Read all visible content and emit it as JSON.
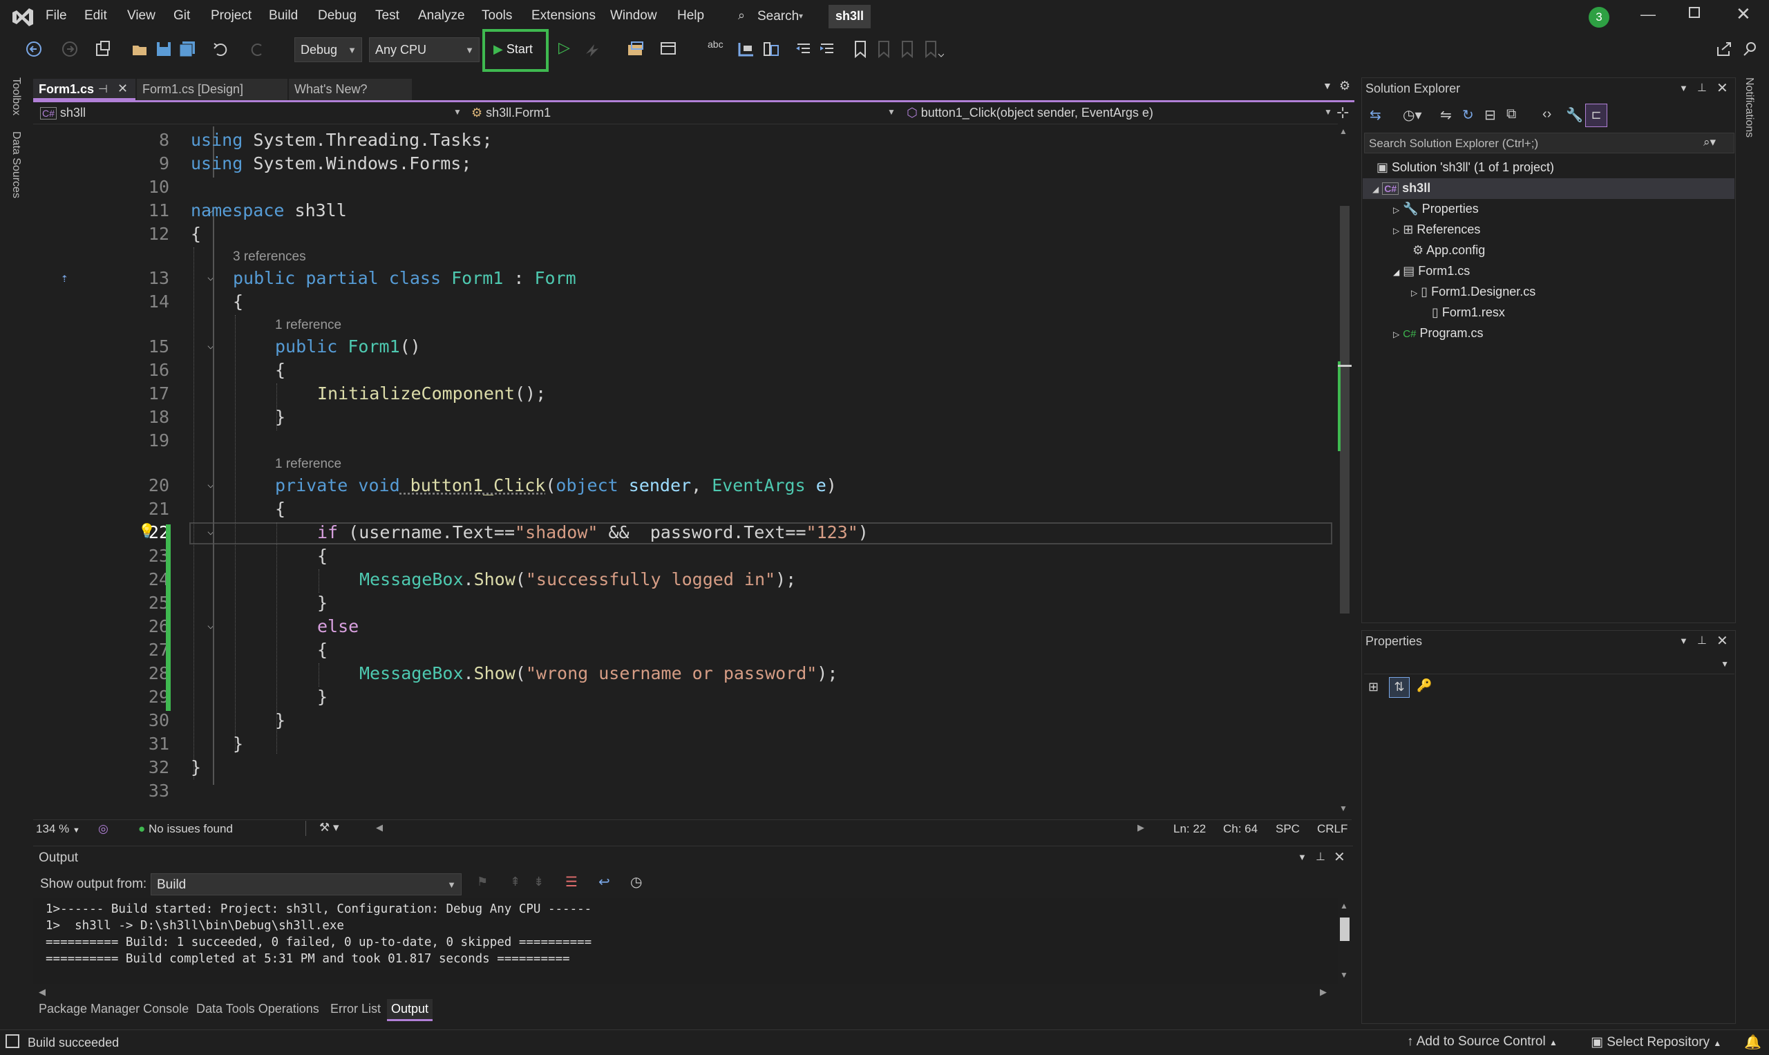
{
  "menu": [
    "File",
    "Edit",
    "View",
    "Git",
    "Project",
    "Build",
    "Debug",
    "Test",
    "Analyze",
    "Tools",
    "Extensions",
    "Window",
    "Help"
  ],
  "search_label": "Search",
  "solution_badge": "sh3ll",
  "notification_count": "3",
  "toolbar": {
    "config": "Debug",
    "platform": "Any CPU",
    "start_label": "Start"
  },
  "side_left": [
    "Toolbox",
    "Data Sources"
  ],
  "side_right": [
    "Notifications"
  ],
  "tabs": [
    {
      "label": "Form1.cs",
      "active": true
    },
    {
      "label": "Form1.cs [Design]",
      "active": false
    },
    {
      "label": "What's New?",
      "active": false
    }
  ],
  "nav": {
    "project": "sh3ll",
    "class": "sh3ll.Form1",
    "member": "button1_Click(object sender, EventArgs e)"
  },
  "code": {
    "line_numbers": [
      "8",
      "9",
      "10",
      "11",
      "12",
      "13",
      "14",
      "15",
      "16",
      "17",
      "18",
      "19",
      "20",
      "21",
      "22",
      "23",
      "24",
      "25",
      "26",
      "27",
      "28",
      "29",
      "30",
      "31",
      "32",
      "33"
    ],
    "l8_kw": "using",
    "l8_rest": " System.Threading.Tasks;",
    "l9_kw": "using",
    "l9_rest": " System.Windows.Forms;",
    "l11_kw": "namespace",
    "l11_name": " sh3ll",
    "l12": "{",
    "lens_class": "3 references",
    "l13_kw": "public partial class",
    "l13_name": " Form1",
    "l13_colon": " : ",
    "l13_base": "Form",
    "l14": "{",
    "lens_ctor": "1 reference",
    "l15_kw": "public",
    "l15_name": " Form1",
    "l15_par": "()",
    "l16": "{",
    "l17_fn": "InitializeComponent",
    "l17_rest": "();",
    "l18": "}",
    "lens_click": "1 reference",
    "l20_kw": "private void",
    "l20_fn": " button1_Click",
    "l20_p1": "(",
    "l20_t1": "object",
    "l20_n1": " sender",
    "l20_c": ", ",
    "l20_t2": "EventArgs",
    "l20_n2": " e",
    "l20_p2": ")",
    "l21": "{",
    "l22_ctl": "if",
    "l22_a": " (",
    "l22_b": "username",
    "l22_c": ".",
    "l22_d": "Text",
    "l22_e": "==",
    "l22_s1": "\"shadow\"",
    "l22_f": " &&  ",
    "l22_g": "password",
    "l22_h": ".",
    "l22_i": "Text",
    "l22_j": "==",
    "l22_s2": "\"123\"",
    "l22_k": ")",
    "l23": "{",
    "l24_ty": "MessageBox",
    "l24_dot": ".",
    "l24_fn": "Show",
    "l24_p": "(",
    "l24_s": "\"successfully logged in\"",
    "l24_e": ");",
    "l25": "}",
    "l26_ctl": "else",
    "l27": "{",
    "l28_ty": "MessageBox",
    "l28_dot": ".",
    "l28_fn": "Show",
    "l28_p": "(",
    "l28_s": "\"wrong username or password\"",
    "l28_e": ");",
    "l29": "}",
    "l30": "}",
    "l31": "}",
    "l32": "}"
  },
  "editor_status": {
    "zoom": "134 %",
    "issues": "No issues found",
    "ln": "Ln: 22",
    "ch": "Ch: 64",
    "spc": "SPC",
    "crlf": "CRLF"
  },
  "solution_explorer": {
    "title": "Solution Explorer",
    "search_placeholder": "Search Solution Explorer (Ctrl+;)",
    "solution": "Solution 'sh3ll' (1 of 1 project)",
    "project": "sh3ll",
    "items": [
      "Properties",
      "References",
      "App.config",
      "Form1.cs",
      "Form1.Designer.cs",
      "Form1.resx",
      "Program.cs"
    ]
  },
  "properties_panel": {
    "title": "Properties"
  },
  "output": {
    "title": "Output",
    "show_from_label": "Show output from:",
    "source": "Build",
    "lines": [
      "1>------ Build started: Project: sh3ll, Configuration: Debug Any CPU ------",
      "1>  sh3ll -> D:\\sh3ll\\bin\\Debug\\sh3ll.exe",
      "========== Build: 1 succeeded, 0 failed, 0 up-to-date, 0 skipped ==========",
      "========== Build completed at 5:31 PM and took 01.817 seconds =========="
    ]
  },
  "bottom_tabs": [
    "Package Manager Console",
    "Data Tools Operations",
    "Error List",
    "Output"
  ],
  "statusbar": {
    "message": "Build succeeded",
    "source_control": "Add to Source Control",
    "repo": "Select Repository"
  },
  "colors": {
    "accent": "#b180d7",
    "start_highlight": "#3fb950",
    "keyword": "#569cd6",
    "type": "#4ec9b0",
    "method": "#dcdcaa",
    "string": "#d69d85",
    "control": "#d8a0df"
  }
}
